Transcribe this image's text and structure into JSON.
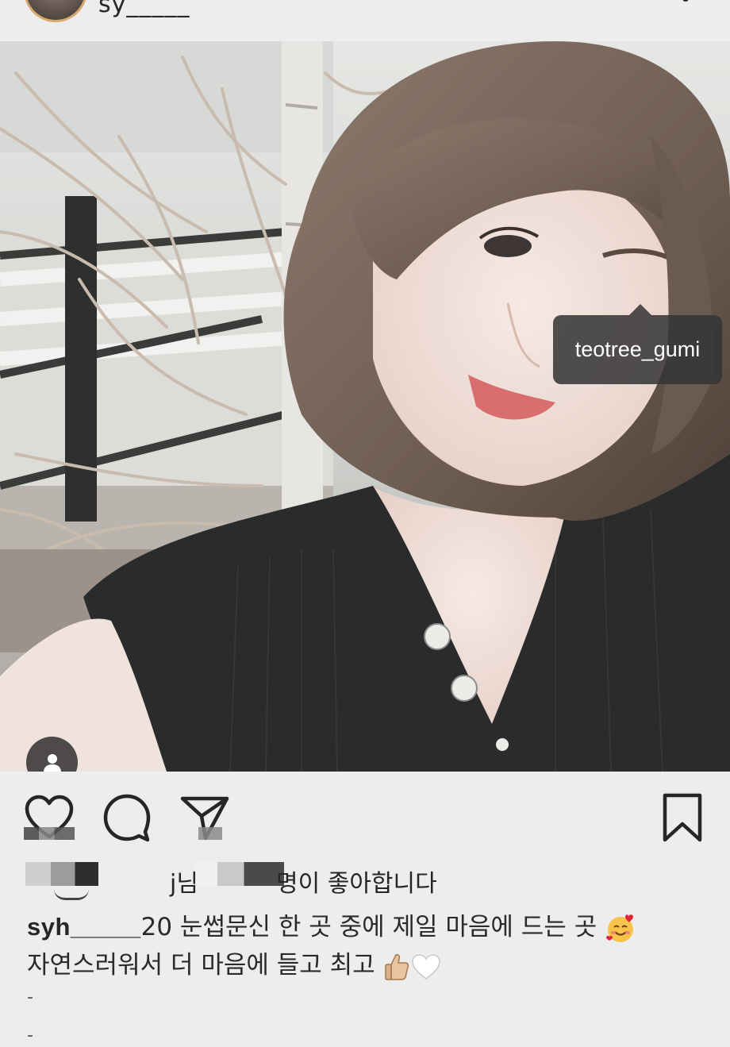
{
  "header": {
    "username_cropped": "sy_____ ",
    "more_icon": "more-vertical-icon"
  },
  "photo": {
    "tag_label": "teotree_gumi",
    "tagged_users_icon": "person-icon"
  },
  "actions": {
    "like_icon": "heart-icon",
    "comment_icon": "comment-icon",
    "share_icon": "paper-plane-icon",
    "save_icon": "bookmark-icon"
  },
  "likes": {
    "name_suffix": "j님",
    "count_suffix": "명이 좋아합니다"
  },
  "caption": {
    "username": "syh_____",
    "line1": "20 눈썹문신 한 곳 중에 제일 마음에 드는 곳 ",
    "line2": "자연스러워서 더 마음에 들고 최고 ",
    "emoji1": "smiling-face-with-hearts",
    "emoji2": "thumbs-up",
    "emoji3": "white-heart"
  },
  "extra_lines": [
    "-",
    "-"
  ],
  "colors": {
    "background": "#ededed",
    "text": "#262626",
    "tag_bubble": "#343434",
    "avatar_ring": "#d7a86e"
  }
}
